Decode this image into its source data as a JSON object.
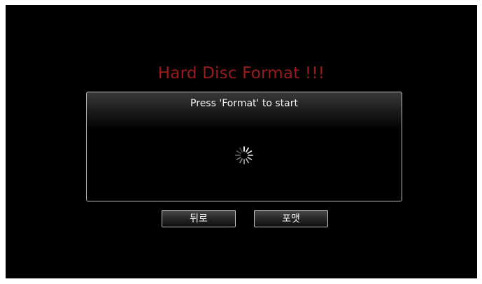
{
  "dialog": {
    "title": "Hard Disc Format !!!",
    "message": "Press 'Format' to start",
    "spinner_icon": "loading-spinner-icon"
  },
  "buttons": {
    "back_label": "뒤로",
    "format_label": "포맷"
  },
  "colors": {
    "title": "#9a1b1b",
    "background": "#000000",
    "border": "#bdbdbd"
  }
}
